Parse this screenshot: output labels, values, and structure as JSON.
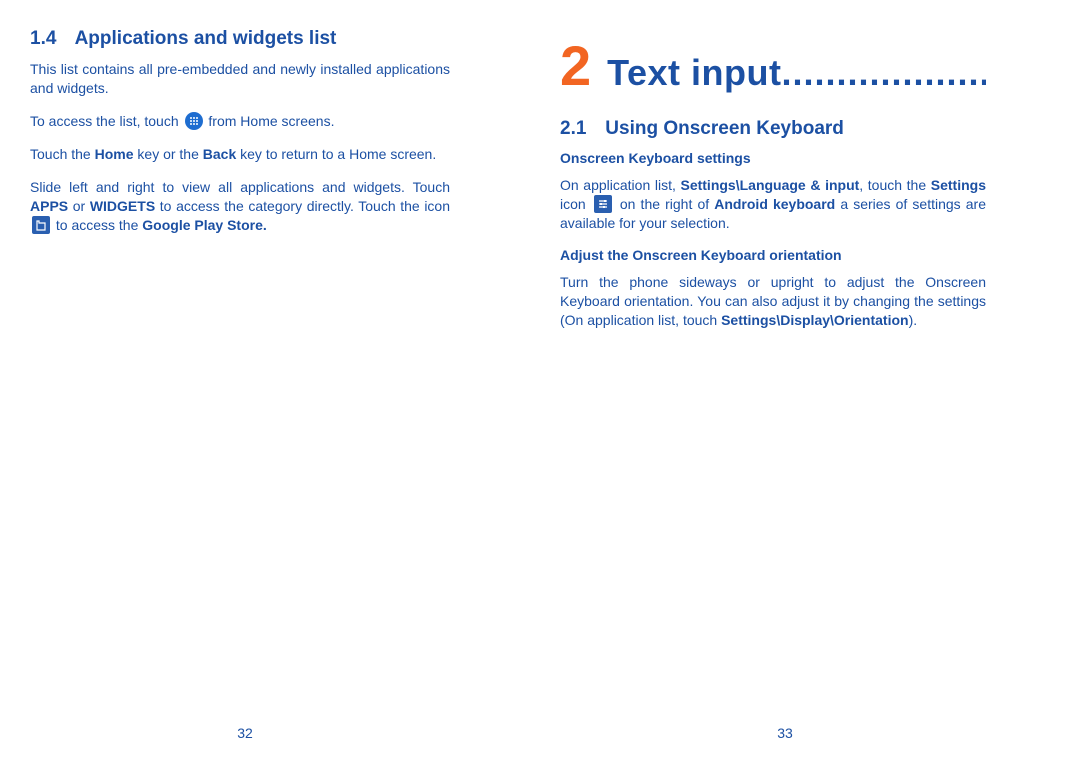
{
  "left": {
    "section_num": "1.4",
    "section_title": "Applications and widgets list",
    "p1": "This list contains all pre-embedded and newly installed applications and widgets.",
    "p2a": "To access the list, touch ",
    "p2b": " from Home screens.",
    "p3a": "Touch the ",
    "p3_home": "Home",
    "p3b": " key or the ",
    "p3_back": "Back",
    "p3c": " key to return to a Home screen.",
    "p4a": "Slide left and right to view all applications and widgets. Touch ",
    "p4_apps": "APPS",
    "p4b": " or ",
    "p4_widgets": "WIDGETS",
    "p4c": " to access the category directly. Touch the icon ",
    "p4d": " to access the ",
    "p4_store": "Google Play Store.",
    "page_num": "32"
  },
  "right": {
    "chapter_num": "2",
    "chapter_title": "Text input",
    "chapter_dots": ".............................",
    "section_num": "2.1",
    "section_title": "Using Onscreen Keyboard",
    "sub1": "Onscreen Keyboard settings",
    "p1a": "On application list, ",
    "p1_path": "Settings\\Language & input",
    "p1b": ", touch the ",
    "p1_settings": "Settings",
    "p1c": " icon ",
    "p1d": " on the right of ",
    "p1_android": "Android keyboard",
    "p1e": " a series of settings are available for your selection.",
    "sub2": "Adjust the Onscreen Keyboard orientation",
    "p2a": "Turn the phone sideways or upright to adjust the Onscreen Keyboard orientation. You can also adjust it by changing the settings (On application list, touch ",
    "p2_path": "Settings\\Display\\Orientation",
    "p2b": ").",
    "page_num": "33"
  }
}
